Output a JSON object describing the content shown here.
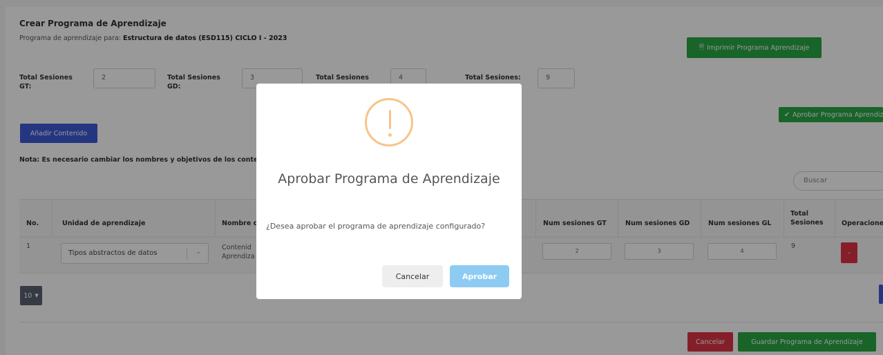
{
  "header": {
    "title": "Crear Programa de Aprendizaje",
    "subtitle_prefix": "Programa de aprendizaje para: ",
    "subtitle_course": "Estructura de datos (ESD115) CICLO I - 2023"
  },
  "buttons": {
    "print": "Imprimir Programa Aprendizaje",
    "approve": "Aprobar Programa Aprendiz",
    "add_content": "Añadir Contenido",
    "page_size": "10",
    "cancel": "Cancelar",
    "save": "Guardar Programa de Aprendizaje"
  },
  "totals": {
    "gt_label_1": "Total Sesiones",
    "gt_label_2": "GT:",
    "gt_value": "2",
    "gd_label_1": "Total Sesiones",
    "gd_label_2": "GD:",
    "gd_value": "3",
    "gl_label": "Total Sesiones",
    "gl_value": "4",
    "all_label": "Total Sesiones:",
    "all_value": "9"
  },
  "note": "Nota: Es necesario cambiar los nombres y objetivos de los conte",
  "search": {
    "placeholder": "Buscar"
  },
  "table": {
    "headers": {
      "no": "No.",
      "unidad": "Unidad de aprendizaje",
      "nombre": "Nombre c",
      "num_gt": "Num sesiones GT",
      "num_gd": "Num sesiones GD",
      "num_gl": "Num sesiones GL",
      "total_1": "Total",
      "total_2": "Sesiones",
      "ops": "Operacione"
    },
    "rows": [
      {
        "no": "1",
        "unidad": "Tipos abstractos de datos",
        "nombre_1": "Contenid",
        "nombre_2": "Aprendiza",
        "gt": "2",
        "gd": "3",
        "gl": "4",
        "total": "9",
        "delete": "-"
      }
    ]
  },
  "modal": {
    "title": "Aprobar Programa de Aprendizaje",
    "text": "¿Desea aprobar el programa de aprendizaje configurado?",
    "cancel": "Cancelar",
    "confirm": "Aprobar"
  },
  "colors": {
    "green": "#28a745",
    "blue": "#3f5bd7",
    "red": "#dc3545",
    "warning": "#f8c486",
    "confirm": "#8ecbf2"
  }
}
